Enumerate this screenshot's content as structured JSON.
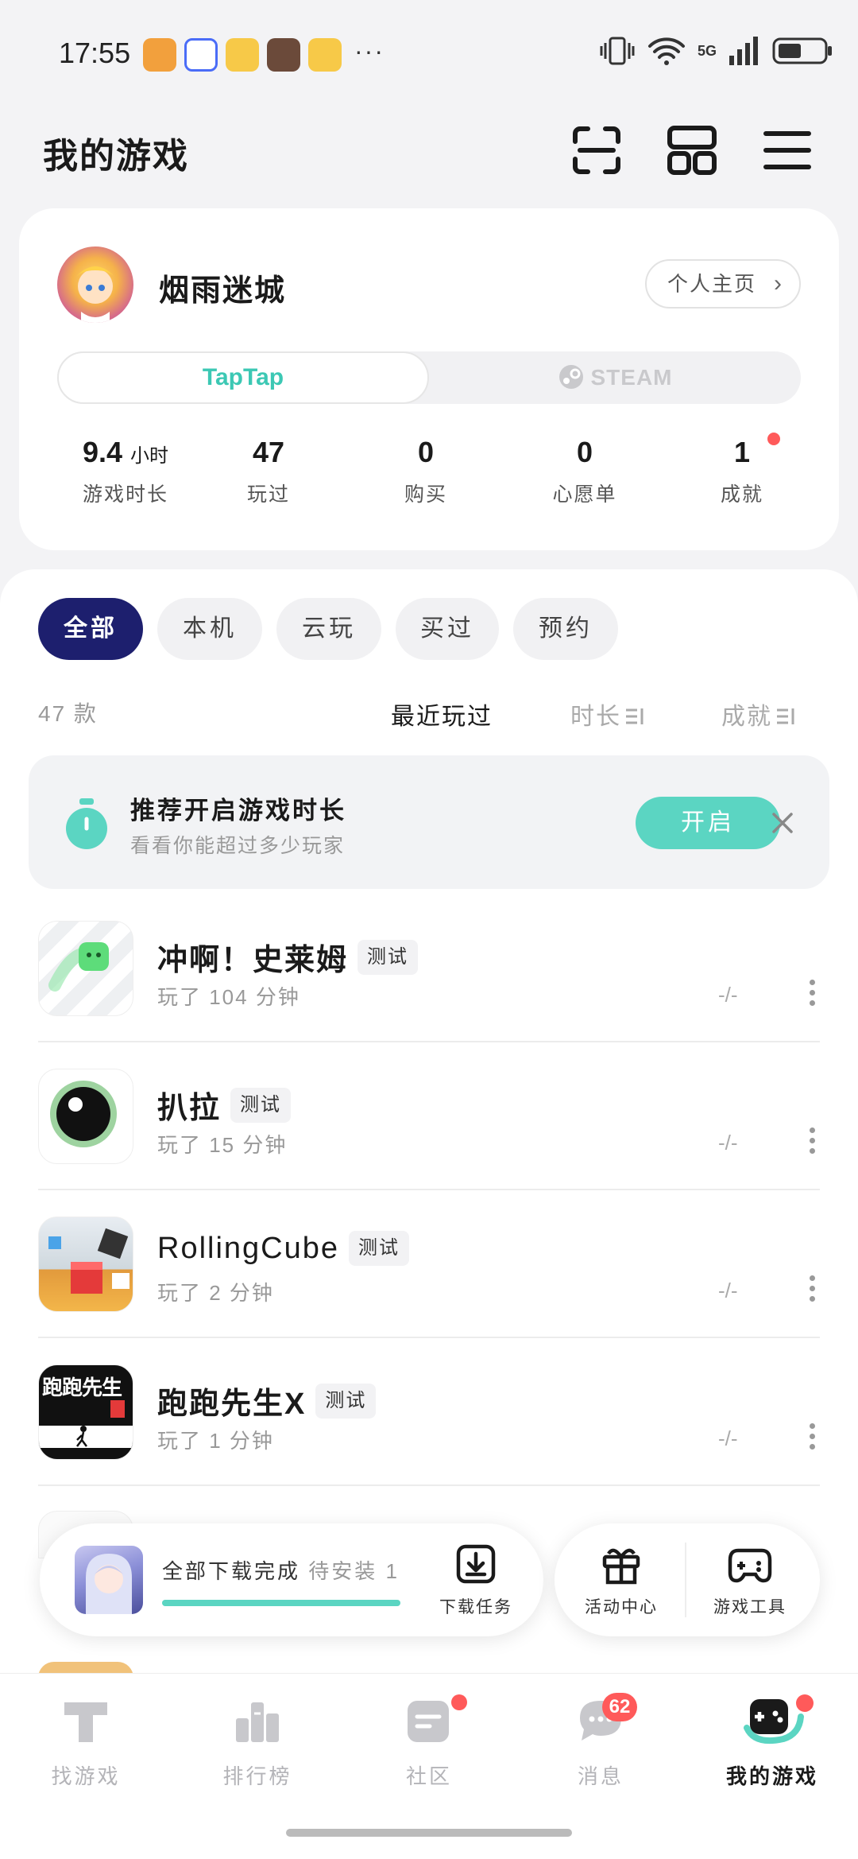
{
  "status_bar": {
    "time": "17:55",
    "more": "···",
    "network": "5G"
  },
  "header": {
    "title": "我的游戏",
    "scan_icon": "scan-icon",
    "grid_icon": "grid-icon",
    "menu_icon": "menu-icon"
  },
  "profile": {
    "username": "烟雨迷城",
    "home_button": "个人主页",
    "platforms": {
      "taptap": "TapTap",
      "steam": "STEAM"
    },
    "stats": [
      {
        "value": "9.4",
        "unit": "小时",
        "label": "游戏时长"
      },
      {
        "value": "47",
        "label": "玩过"
      },
      {
        "value": "0",
        "label": "购买"
      },
      {
        "value": "0",
        "label": "心愿单"
      },
      {
        "value": "1",
        "label": "成就"
      }
    ]
  },
  "filters": [
    "全部",
    "本机",
    "云玩",
    "买过",
    "预约"
  ],
  "list_header": {
    "count": "47 款",
    "sort_recent": "最近玩过",
    "sort_duration": "时长",
    "sort_achievement": "成就"
  },
  "promo": {
    "title": "推荐开启游戏时长",
    "subtitle": "看看你能超过多少玩家",
    "button": "开启"
  },
  "games": [
    {
      "name": "冲啊！史莱姆",
      "tag": "测试",
      "played": "玩了 104 分钟",
      "score": "-/-"
    },
    {
      "name": "扒拉",
      "tag": "测试",
      "played": "玩了 15 分钟",
      "score": "-/-"
    },
    {
      "name": "RollingCube",
      "tag": "测试",
      "played": "玩了 2 分钟",
      "score": "-/-"
    },
    {
      "name": "跑跑先生X",
      "tag": "测试",
      "played": "玩了 1 分钟",
      "score": "-/-"
    }
  ],
  "icon_text": {
    "paopao": "跑跑先生"
  },
  "download": {
    "status": "全部下载完成",
    "pending": "待安装 1",
    "progress": 1.0,
    "task_label": "下载任务"
  },
  "tools": {
    "activity": "活动中心",
    "game_tools": "游戏工具"
  },
  "bottom_nav": [
    {
      "label": "找游戏"
    },
    {
      "label": "排行榜"
    },
    {
      "label": "社区"
    },
    {
      "label": "消息",
      "badge": "62"
    },
    {
      "label": "我的游戏"
    }
  ],
  "colors": {
    "accent": "#5bd5c2",
    "active_chip": "#1d1f6e",
    "badge": "#ff5a5a"
  }
}
